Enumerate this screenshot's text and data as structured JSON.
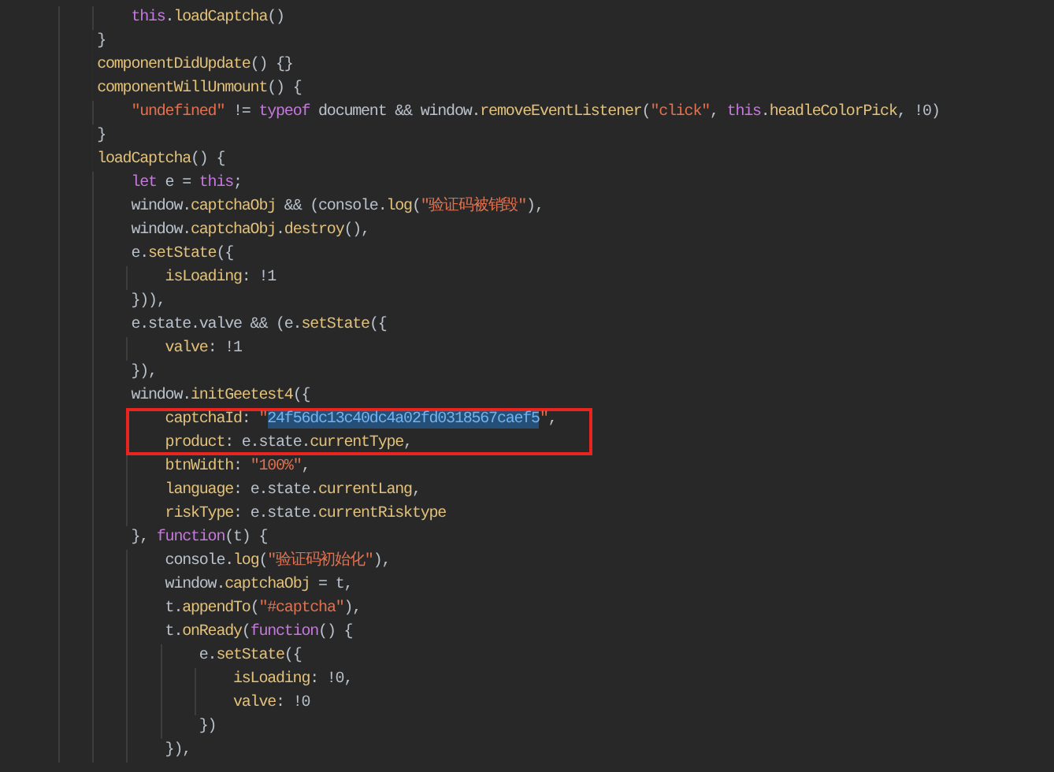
{
  "editor": {
    "lines": [
      {
        "children": [
          {
            "boxed": false,
            "tokens": [
              {
                "kind": "kw",
                "text": "this"
              },
              {
                "kind": "plain",
                "text": "."
              },
              {
                "kind": "fn",
                "text": "loadCaptcha"
              },
              {
                "kind": "plain",
                "text": "()"
              }
            ]
          }
        ]
      },
      {
        "boxed": false,
        "tokens": [
          {
            "kind": "plain",
            "text": "}"
          }
        ]
      },
      {
        "boxed": false,
        "tokens": [
          {
            "kind": "fn",
            "text": "componentDidUpdate"
          },
          {
            "kind": "plain",
            "text": "() {}"
          }
        ]
      },
      {
        "boxed": false,
        "tokens": [
          {
            "kind": "fn",
            "text": "componentWillUnmount"
          },
          {
            "kind": "plain",
            "text": "() {"
          }
        ],
        "children": [
          {
            "boxed": false,
            "tokens": [
              {
                "kind": "str",
                "text": "\"undefined\""
              },
              {
                "kind": "plain",
                "text": " != "
              },
              {
                "kind": "kw",
                "text": "typeof"
              },
              {
                "kind": "plain",
                "text": " document && window."
              },
              {
                "kind": "fn",
                "text": "removeEventListener"
              },
              {
                "kind": "plain",
                "text": "("
              },
              {
                "kind": "str",
                "text": "\"click\""
              },
              {
                "kind": "plain",
                "text": ", "
              },
              {
                "kind": "kw",
                "text": "this"
              },
              {
                "kind": "plain",
                "text": "."
              },
              {
                "kind": "fn",
                "text": "headleColorPick"
              },
              {
                "kind": "plain",
                "text": ", !0)"
              }
            ]
          }
        ]
      },
      {
        "boxed": false,
        "tokens": [
          {
            "kind": "plain",
            "text": "}"
          }
        ]
      },
      {
        "boxed": false,
        "tokens": [
          {
            "kind": "fn",
            "text": "loadCaptcha"
          },
          {
            "kind": "plain",
            "text": "() {"
          }
        ],
        "children": [
          {
            "boxed": false,
            "tokens": [
              {
                "kind": "kw",
                "text": "let"
              },
              {
                "kind": "plain",
                "text": " e = "
              },
              {
                "kind": "kw",
                "text": "this"
              },
              {
                "kind": "plain",
                "text": ";"
              }
            ]
          },
          {
            "boxed": false,
            "tokens": [
              {
                "kind": "plain",
                "text": "window."
              },
              {
                "kind": "fn",
                "text": "captchaObj"
              },
              {
                "kind": "plain",
                "text": " && (console."
              },
              {
                "kind": "fn",
                "text": "log"
              },
              {
                "kind": "plain",
                "text": "("
              },
              {
                "kind": "str",
                "text": "\"验证码被销毁\""
              },
              {
                "kind": "plain",
                "text": "),"
              }
            ]
          },
          {
            "boxed": false,
            "tokens": [
              {
                "kind": "plain",
                "text": "window."
              },
              {
                "kind": "fn",
                "text": "captchaObj"
              },
              {
                "kind": "plain",
                "text": "."
              },
              {
                "kind": "fn",
                "text": "destroy"
              },
              {
                "kind": "plain",
                "text": "(),"
              }
            ]
          },
          {
            "boxed": false,
            "tokens": [
              {
                "kind": "plain",
                "text": "e."
              },
              {
                "kind": "fn",
                "text": "setState"
              },
              {
                "kind": "plain",
                "text": "({"
              }
            ],
            "children": [
              {
                "boxed": false,
                "tokens": [
                  {
                    "kind": "fn",
                    "text": "isLoading"
                  },
                  {
                    "kind": "plain",
                    "text": ": !1"
                  }
                ]
              }
            ]
          },
          {
            "boxed": false,
            "tokens": [
              {
                "kind": "plain",
                "text": "})),"
              }
            ]
          },
          {
            "boxed": false,
            "tokens": [
              {
                "kind": "plain",
                "text": "e.state.valve && (e."
              },
              {
                "kind": "fn",
                "text": "setState"
              },
              {
                "kind": "plain",
                "text": "({"
              }
            ],
            "children": [
              {
                "boxed": false,
                "tokens": [
                  {
                    "kind": "fn",
                    "text": "valve"
                  },
                  {
                    "kind": "plain",
                    "text": ": !1"
                  }
                ]
              }
            ]
          },
          {
            "boxed": false,
            "tokens": [
              {
                "kind": "plain",
                "text": "}),"
              }
            ]
          },
          {
            "boxed": false,
            "tokens": [
              {
                "kind": "plain",
                "text": "window."
              },
              {
                "kind": "fn",
                "text": "initGeetest4"
              },
              {
                "kind": "plain",
                "text": "({"
              }
            ],
            "children": [
              {
                "boxed": true,
                "tokens": [
                  {
                    "kind": "fn",
                    "text": "captchaId"
                  },
                  {
                    "kind": "plain",
                    "text": ": "
                  },
                  {
                    "kind": "str",
                    "text": "\""
                  },
                  {
                    "kind": "selection",
                    "text": "24f56dc13c40dc4a02fd0318567caef5"
                  },
                  {
                    "kind": "str",
                    "text": "\""
                  },
                  {
                    "kind": "plain",
                    "text": ","
                  }
                ]
              },
              {
                "boxed": true,
                "tokens": [
                  {
                    "kind": "fn",
                    "text": "product"
                  },
                  {
                    "kind": "plain",
                    "text": ": e.state."
                  },
                  {
                    "kind": "fn",
                    "text": "currentType"
                  },
                  {
                    "kind": "plain",
                    "text": ","
                  }
                ]
              },
              {
                "boxed": false,
                "tokens": [
                  {
                    "kind": "fn",
                    "text": "btnWidth"
                  },
                  {
                    "kind": "plain",
                    "text": ": "
                  },
                  {
                    "kind": "str",
                    "text": "\"100%\""
                  },
                  {
                    "kind": "plain",
                    "text": ","
                  }
                ]
              },
              {
                "boxed": false,
                "tokens": [
                  {
                    "kind": "fn",
                    "text": "language"
                  },
                  {
                    "kind": "plain",
                    "text": ": e.state."
                  },
                  {
                    "kind": "fn",
                    "text": "currentLang"
                  },
                  {
                    "kind": "plain",
                    "text": ","
                  }
                ]
              },
              {
                "boxed": false,
                "tokens": [
                  {
                    "kind": "fn",
                    "text": "riskType"
                  },
                  {
                    "kind": "plain",
                    "text": ": e.state."
                  },
                  {
                    "kind": "fn",
                    "text": "currentRisktype"
                  }
                ]
              }
            ]
          },
          {
            "boxed": false,
            "tokens": [
              {
                "kind": "plain",
                "text": "}, "
              },
              {
                "kind": "kw",
                "text": "function"
              },
              {
                "kind": "plain",
                "text": "(t) {"
              }
            ],
            "children": [
              {
                "boxed": false,
                "tokens": [
                  {
                    "kind": "plain",
                    "text": "console."
                  },
                  {
                    "kind": "fn",
                    "text": "log"
                  },
                  {
                    "kind": "plain",
                    "text": "("
                  },
                  {
                    "kind": "str",
                    "text": "\"验证码初始化\""
                  },
                  {
                    "kind": "plain",
                    "text": "),"
                  }
                ]
              },
              {
                "boxed": false,
                "tokens": [
                  {
                    "kind": "plain",
                    "text": "window."
                  },
                  {
                    "kind": "fn",
                    "text": "captchaObj"
                  },
                  {
                    "kind": "plain",
                    "text": " = t,"
                  }
                ]
              },
              {
                "boxed": false,
                "tokens": [
                  {
                    "kind": "plain",
                    "text": "t."
                  },
                  {
                    "kind": "fn",
                    "text": "appendTo"
                  },
                  {
                    "kind": "plain",
                    "text": "("
                  },
                  {
                    "kind": "str",
                    "text": "\"#captcha\""
                  },
                  {
                    "kind": "plain",
                    "text": "),"
                  }
                ]
              },
              {
                "boxed": false,
                "tokens": [
                  {
                    "kind": "plain",
                    "text": "t."
                  },
                  {
                    "kind": "fn",
                    "text": "onReady"
                  },
                  {
                    "kind": "plain",
                    "text": "("
                  },
                  {
                    "kind": "kw",
                    "text": "function"
                  },
                  {
                    "kind": "plain",
                    "text": "() {"
                  }
                ],
                "children": [
                  {
                    "boxed": false,
                    "tokens": [
                      {
                        "kind": "plain",
                        "text": "e."
                      },
                      {
                        "kind": "fn",
                        "text": "setState"
                      },
                      {
                        "kind": "plain",
                        "text": "({"
                      }
                    ],
                    "children": [
                      {
                        "boxed": false,
                        "tokens": [
                          {
                            "kind": "fn",
                            "text": "isLoading"
                          },
                          {
                            "kind": "plain",
                            "text": ": !0,"
                          }
                        ]
                      },
                      {
                        "boxed": false,
                        "tokens": [
                          {
                            "kind": "fn",
                            "text": "valve"
                          },
                          {
                            "kind": "plain",
                            "text": ": !0"
                          }
                        ]
                      }
                    ]
                  },
                  {
                    "boxed": false,
                    "tokens": [
                      {
                        "kind": "plain",
                        "text": "})"
                      }
                    ]
                  }
                ]
              },
              {
                "boxed": false,
                "tokens": [
                  {
                    "kind": "plain",
                    "text": "}),"
                  }
                ]
              }
            ]
          }
        ]
      }
    ]
  }
}
